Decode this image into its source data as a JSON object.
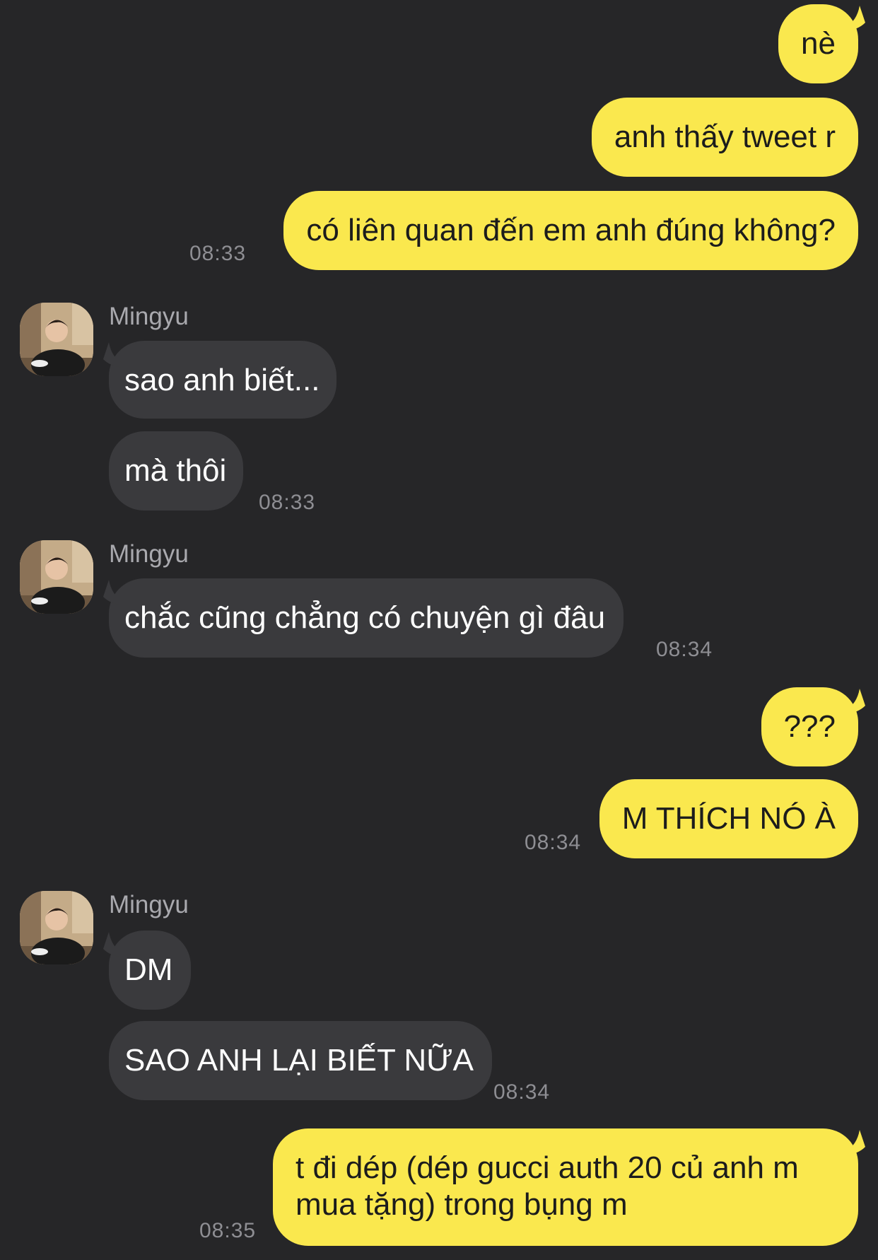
{
  "colors": {
    "background": "#262628",
    "outgoing_bubble": "#FAE84E",
    "incoming_bubble": "#3A3A3D",
    "timestamp": "#8E8E93",
    "sender_name": "#A9A9AE"
  },
  "sender_name": "Mingyu",
  "messages": {
    "m1": "nè",
    "m2": "anh thấy tweet r",
    "m3": "có liên quan đến em anh đúng không?",
    "m4": "sao anh biết...",
    "m5": "mà thôi",
    "m6": "chắc cũng chẳng có chuyện gì đâu",
    "m7": "???",
    "m8": "M THÍCH NÓ À",
    "m9": "DM",
    "m10": "SAO ANH LẠI BIẾT NỮA",
    "m11": "t đi dép (dép gucci auth 20 củ anh m mua tặng) trong bụng m"
  },
  "times": {
    "t1": "08:33",
    "t2": "08:33",
    "t3": "08:34",
    "t4": "08:34",
    "t5": "08:34",
    "t6": "08:35"
  },
  "icons": {
    "avatar": "profile-photo-avatar"
  }
}
